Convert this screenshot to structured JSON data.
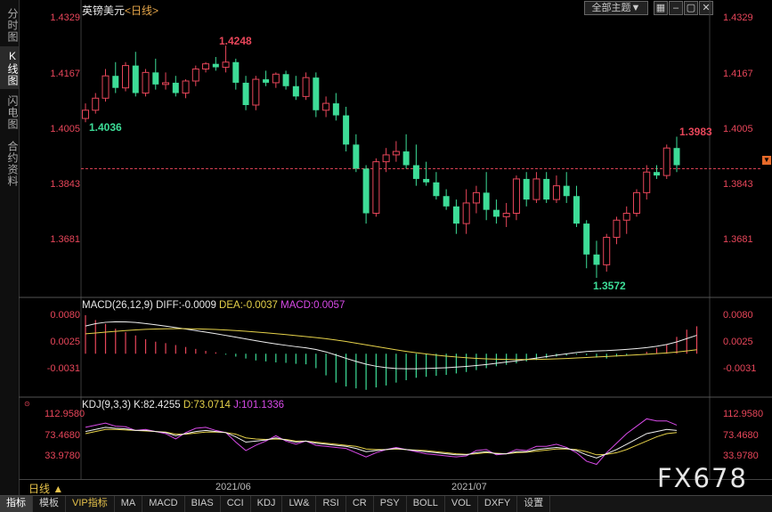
{
  "sidebar": {
    "tabs": [
      {
        "label": "分时图",
        "active": false
      },
      {
        "label": "K线图",
        "active": true
      },
      {
        "label": "闪电图",
        "active": false
      },
      {
        "label": "合约资料",
        "active": false
      }
    ]
  },
  "header": {
    "instrument": "英镑美元",
    "period": "<日线>",
    "theme_button": "全部主题▼"
  },
  "main_chart": {
    "price_ticks": [
      "1.4329",
      "1.4167",
      "1.4005",
      "1.3843",
      "1.3681"
    ],
    "high_marker": "1.4248",
    "low_marker": "1.3572",
    "start_marker": "1.4036",
    "last_marker": "1.3983",
    "current_price_line": 1.389,
    "up_color": "#e8465a",
    "down_color": "#3ddc97"
  },
  "macd": {
    "title": "MACD(26,12,9)",
    "diff": "DIFF:-0.0009",
    "dea": "DEA:-0.0037",
    "macd": "MACD:0.0057",
    "ticks": [
      "0.0080",
      "0.0025",
      "-0.0031"
    ]
  },
  "kdj": {
    "title": "KDJ(9,3,3)",
    "k": "K:82.4255",
    "d": "D:73.0714",
    "j": "J:101.1336",
    "ticks": [
      "112.9580",
      "73.4680",
      "33.9780"
    ]
  },
  "time_axis": {
    "period_selector": "日线 ▲",
    "dates": [
      "2021/06",
      "2021/07"
    ]
  },
  "bottom_tabs": [
    "指标",
    "模板",
    "VIP指标",
    "MA",
    "MACD",
    "BIAS",
    "CCI",
    "KDJ",
    "LW&",
    "RSI",
    "CR",
    "PSY",
    "BOLL",
    "VOL",
    "DXFY",
    "设置"
  ],
  "watermark": "FX678",
  "chart_data": {
    "type": "candlestick",
    "ylim": [
      1.356,
      1.4329
    ],
    "candles": [
      [
        1.4036,
        1.408,
        1.4025,
        1.406
      ],
      [
        1.406,
        1.411,
        1.405,
        1.4095
      ],
      [
        1.4095,
        1.418,
        1.4085,
        1.416
      ],
      [
        1.416,
        1.42,
        1.411,
        1.4125
      ],
      [
        1.4125,
        1.42,
        1.4115,
        1.419
      ],
      [
        1.419,
        1.423,
        1.41,
        1.411
      ],
      [
        1.411,
        1.418,
        1.41,
        1.417
      ],
      [
        1.417,
        1.421,
        1.412,
        1.4135
      ],
      [
        1.4135,
        1.417,
        1.412,
        1.414
      ],
      [
        1.414,
        1.416,
        1.41,
        1.411
      ],
      [
        1.411,
        1.415,
        1.4095,
        1.4145
      ],
      [
        1.4145,
        1.419,
        1.413,
        1.418
      ],
      [
        1.418,
        1.42,
        1.417,
        1.4195
      ],
      [
        1.4195,
        1.4215,
        1.4175,
        1.4185
      ],
      [
        1.4185,
        1.4248,
        1.417,
        1.42
      ],
      [
        1.42,
        1.421,
        1.412,
        1.414
      ],
      [
        1.414,
        1.416,
        1.406,
        1.4075
      ],
      [
        1.4075,
        1.416,
        1.406,
        1.415
      ],
      [
        1.415,
        1.4175,
        1.413,
        1.414
      ],
      [
        1.414,
        1.417,
        1.4125,
        1.4165
      ],
      [
        1.4165,
        1.4175,
        1.412,
        1.413
      ],
      [
        1.413,
        1.416,
        1.409,
        1.41
      ],
      [
        1.41,
        1.417,
        1.409,
        1.4155
      ],
      [
        1.4155,
        1.417,
        1.404,
        1.406
      ],
      [
        1.406,
        1.41,
        1.404,
        1.408
      ],
      [
        1.408,
        1.411,
        1.403,
        1.4045
      ],
      [
        1.4045,
        1.407,
        1.394,
        1.396
      ],
      [
        1.396,
        1.399,
        1.388,
        1.389
      ],
      [
        1.389,
        1.39,
        1.373,
        1.376
      ],
      [
        1.376,
        1.392,
        1.375,
        1.391
      ],
      [
        1.391,
        1.395,
        1.388,
        1.393
      ],
      [
        1.393,
        1.397,
        1.391,
        1.394
      ],
      [
        1.394,
        1.399,
        1.389,
        1.39
      ],
      [
        1.39,
        1.396,
        1.384,
        1.386
      ],
      [
        1.386,
        1.391,
        1.384,
        1.385
      ],
      [
        1.385,
        1.388,
        1.38,
        1.381
      ],
      [
        1.381,
        1.383,
        1.377,
        1.378
      ],
      [
        1.378,
        1.38,
        1.37,
        1.373
      ],
      [
        1.373,
        1.383,
        1.37,
        1.379
      ],
      [
        1.379,
        1.384,
        1.376,
        1.382
      ],
      [
        1.382,
        1.388,
        1.374,
        1.377
      ],
      [
        1.377,
        1.38,
        1.373,
        1.375
      ],
      [
        1.375,
        1.379,
        1.372,
        1.376
      ],
      [
        1.376,
        1.387,
        1.374,
        1.386
      ],
      [
        1.386,
        1.388,
        1.378,
        1.38
      ],
      [
        1.38,
        1.388,
        1.379,
        1.386
      ],
      [
        1.386,
        1.388,
        1.379,
        1.38
      ],
      [
        1.38,
        1.387,
        1.379,
        1.384
      ],
      [
        1.384,
        1.388,
        1.379,
        1.381
      ],
      [
        1.381,
        1.384,
        1.372,
        1.373
      ],
      [
        1.373,
        1.374,
        1.36,
        1.364
      ],
      [
        1.364,
        1.368,
        1.3572,
        1.361
      ],
      [
        1.361,
        1.37,
        1.359,
        1.369
      ],
      [
        1.369,
        1.375,
        1.367,
        1.374
      ],
      [
        1.374,
        1.378,
        1.37,
        1.376
      ],
      [
        1.376,
        1.383,
        1.375,
        1.382
      ],
      [
        1.382,
        1.39,
        1.38,
        1.388
      ],
      [
        1.388,
        1.39,
        1.386,
        1.387
      ],
      [
        1.387,
        1.396,
        1.386,
        1.395
      ],
      [
        1.395,
        1.3983,
        1.388,
        1.39
      ]
    ],
    "macd_hist": [
      0.008,
      0.007,
      0.0062,
      0.0052,
      0.0045,
      0.0038,
      0.003,
      0.0025,
      0.0022,
      0.0018,
      0.0014,
      0.001,
      0.0006,
      0.0003,
      -0.0002,
      -0.0006,
      -0.001,
      -0.0014,
      -0.0016,
      -0.0018,
      -0.0019,
      -0.0021,
      -0.0022,
      -0.003,
      -0.0045,
      -0.006,
      -0.0068,
      -0.0072,
      -0.0075,
      -0.007,
      -0.0066,
      -0.006,
      -0.0055,
      -0.005,
      -0.0048,
      -0.0046,
      -0.0044,
      -0.0041,
      -0.0038,
      -0.0034,
      -0.003,
      -0.0026,
      -0.0023,
      -0.002,
      -0.0016,
      -0.0013,
      -0.0009,
      -0.0006,
      -0.0004,
      -0.0002,
      -0.0003,
      -0.0008,
      -0.001,
      -0.0006,
      -0.0003,
      0.0,
      0.0004,
      0.0012,
      0.002,
      0.0035,
      0.005,
      0.0057
    ],
    "kdj_k": [
      80,
      84,
      88,
      86,
      85,
      82,
      82,
      80,
      78,
      72,
      76,
      80,
      82,
      80,
      78,
      70,
      60,
      62,
      64,
      68,
      64,
      60,
      62,
      58,
      56,
      54,
      52,
      48,
      42,
      44,
      46,
      48,
      46,
      44,
      42,
      40,
      38,
      36,
      36,
      40,
      42,
      38,
      38,
      42,
      42,
      46,
      48,
      50,
      48,
      44,
      36,
      30,
      38,
      46,
      56,
      66,
      76,
      80,
      84,
      82
    ],
    "kdj_d": [
      76,
      80,
      84,
      84,
      83,
      82,
      81,
      80,
      79,
      75,
      75,
      77,
      79,
      79,
      78,
      75,
      68,
      66,
      65,
      66,
      65,
      62,
      62,
      60,
      58,
      56,
      54,
      52,
      47,
      46,
      46,
      47,
      46,
      45,
      44,
      42,
      40,
      38,
      37,
      38,
      40,
      39,
      38,
      40,
      41,
      43,
      45,
      47,
      47,
      46,
      42,
      36,
      37,
      40,
      46,
      54,
      62,
      70,
      76,
      78
    ],
    "kdj_j": [
      88,
      92,
      96,
      90,
      89,
      82,
      84,
      80,
      76,
      66,
      78,
      86,
      88,
      82,
      78,
      60,
      44,
      54,
      62,
      72,
      62,
      56,
      62,
      54,
      52,
      50,
      48,
      40,
      32,
      40,
      46,
      50,
      46,
      42,
      38,
      36,
      34,
      32,
      34,
      44,
      46,
      36,
      38,
      46,
      44,
      52,
      52,
      56,
      50,
      40,
      24,
      18,
      40,
      58,
      76,
      90,
      104,
      100,
      100,
      92
    ]
  }
}
